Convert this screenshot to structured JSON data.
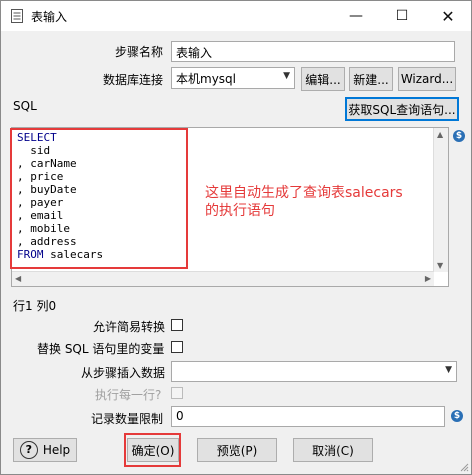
{
  "window": {
    "title": "表输入"
  },
  "form": {
    "step_name_label": "步骤名称",
    "step_name_value": "表输入",
    "db_conn_label": "数据库连接",
    "db_conn_value": "本机mysql",
    "edit_button": "编辑...",
    "new_button": "新建...",
    "wizard_button": "Wizard...",
    "sql_label": "SQL",
    "get_sql_button": "获取SQL查询语句..."
  },
  "sql": {
    "lines": [
      {
        "kw": "SELECT",
        "rest": ""
      },
      {
        "kw": "",
        "rest": "  sid"
      },
      {
        "kw": "",
        "rest": ", carName"
      },
      {
        "kw": "",
        "rest": ", price"
      },
      {
        "kw": "",
        "rest": ", buyDate"
      },
      {
        "kw": "",
        "rest": ", payer"
      },
      {
        "kw": "",
        "rest": ", email"
      },
      {
        "kw": "",
        "rest": ", mobile"
      },
      {
        "kw": "",
        "rest": ", address"
      },
      {
        "kw": "FROM",
        "rest": " salecars"
      }
    ]
  },
  "annotation": {
    "line1": "这里自动生成了查询表salecars",
    "line2": "的执行语句"
  },
  "status": {
    "position": "行1 列0"
  },
  "options": {
    "lazy_conversion_label": "允许简易转换",
    "replace_vars_label": "替换 SQL 语句里的变量",
    "insert_from_step_label": "从步骤插入数据",
    "execute_each_row_label": "执行每一行?",
    "limit_label": "记录数量限制",
    "limit_value": "0"
  },
  "buttons": {
    "help": "Help",
    "ok": "确定(O)",
    "preview": "预览(P)",
    "cancel": "取消(C)"
  }
}
